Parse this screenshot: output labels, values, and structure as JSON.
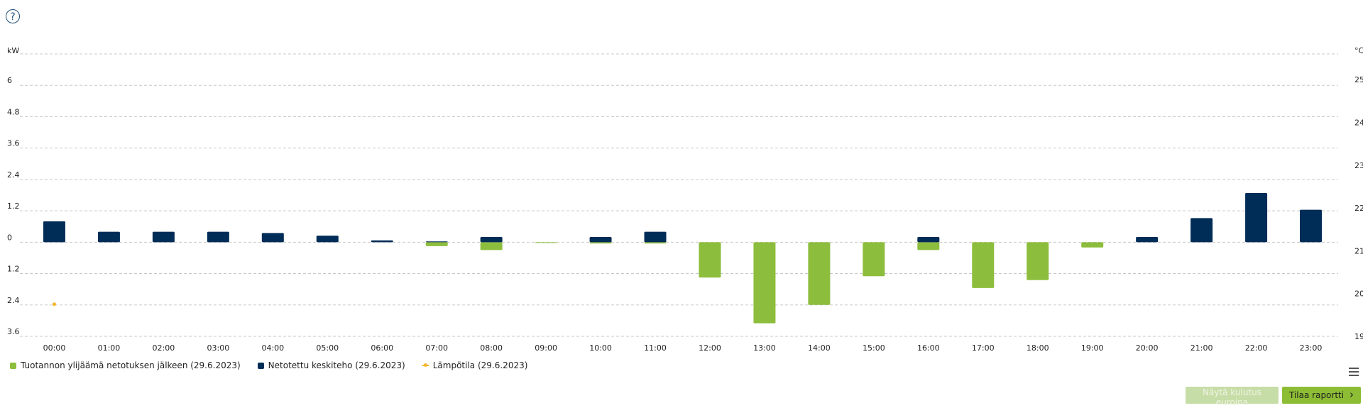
{
  "help_symbol": "?",
  "colors": {
    "production": "#8dbd3c",
    "netted": "#002d57",
    "temperature": "#f5b52a",
    "grid": "#c8c8c8"
  },
  "chart_data": {
    "type": "bar",
    "x": [
      "00:00",
      "01:00",
      "02:00",
      "03:00",
      "04:00",
      "05:00",
      "06:00",
      "07:00",
      "08:00",
      "09:00",
      "10:00",
      "11:00",
      "12:00",
      "13:00",
      "14:00",
      "15:00",
      "16:00",
      "17:00",
      "18:00",
      "19:00",
      "20:00",
      "21:00",
      "22:00",
      "23:00"
    ],
    "y_axis_left": {
      "unit": "kW",
      "ticks": [
        "6",
        "4.8",
        "3.6",
        "2.4",
        "1.2",
        "0",
        "1.2",
        "2.4",
        "3.6"
      ],
      "tick_values": [
        6,
        4.8,
        3.6,
        2.4,
        1.2,
        0,
        -1.2,
        -2.4,
        -3.6
      ],
      "range": [
        -3.6,
        7.2
      ]
    },
    "y_axis_right": {
      "unit": "°C",
      "ticks": [
        "25",
        "24",
        "23",
        "22",
        "21",
        "20",
        "19"
      ],
      "tick_values": [
        25,
        24,
        23,
        22,
        21,
        20,
        19
      ],
      "range": [
        19,
        25.6
      ]
    },
    "grid": true,
    "legend_position": "bottom-left",
    "series": [
      {
        "name": "Tuotannon ylijäämä netotuksen jälkeen (29.6.2023)",
        "type": "bar",
        "axis": "left",
        "values": [
          0,
          0,
          0,
          0,
          0,
          0,
          0,
          -0.15,
          -0.3,
          -0.02,
          -0.05,
          -0.05,
          -1.35,
          -3.1,
          -2.4,
          -1.3,
          -0.3,
          -1.75,
          -1.45,
          -0.2,
          0,
          0,
          0,
          0
        ]
      },
      {
        "name": "Netotettu keskiteho (29.6.2023)",
        "type": "bar",
        "axis": "left",
        "values": [
          0.8,
          0.4,
          0.4,
          0.4,
          0.35,
          0.25,
          0.07,
          0.03,
          0.2,
          0,
          0.2,
          0.4,
          0,
          0,
          0,
          0,
          0.2,
          0,
          0,
          0,
          0.2,
          0.92,
          1.88,
          1.24
        ]
      },
      {
        "name": "Lämpötila (29.6.2023)",
        "type": "line",
        "axis": "right",
        "values": [
          19.75,
          null,
          null,
          null,
          null,
          null,
          null,
          null,
          null,
          null,
          null,
          null,
          null,
          null,
          null,
          null,
          null,
          null,
          null,
          null,
          null,
          null,
          null,
          null
        ]
      }
    ]
  },
  "buttons": {
    "show_costs": "Näytä kulutus euroina",
    "order_report": "Tilaa raportti",
    "order_report_icon": "›"
  }
}
